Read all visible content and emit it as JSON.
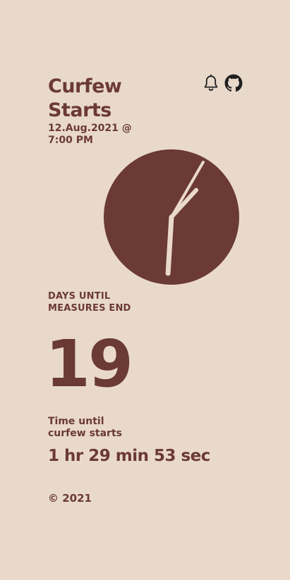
{
  "header": {
    "title": "Curfew Starts",
    "date": "12.Aug.2021 @ 7:00 PM",
    "icons": [
      "bell-icon",
      "github-icon"
    ]
  },
  "clock": {
    "hour": 6,
    "minute": 7,
    "second": 5,
    "face_color": "#6b3a35",
    "hand_color": "#e9d9cb"
  },
  "days": {
    "label": "DAYS UNTIL MEASURES END",
    "value": "19"
  },
  "countdown": {
    "label": "Time until curfew starts",
    "value": "1 hr 29 min 53 sec"
  },
  "footer": {
    "copyright": "© 2021"
  },
  "colors": {
    "background": "#e9d9cb",
    "accent": "#6b3a35"
  }
}
